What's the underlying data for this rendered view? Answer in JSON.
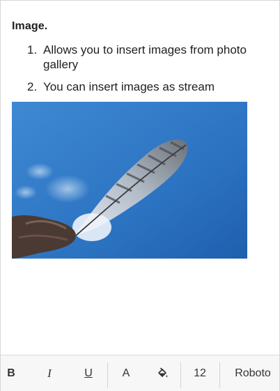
{
  "content": {
    "heading": "Image.",
    "list": [
      {
        "number": "1.",
        "text": "Allows you to insert images from photo gallery"
      },
      {
        "number": "2.",
        "text": "You can insert images as stream"
      }
    ]
  },
  "image": {
    "subject": "feather against blue sky",
    "sky_color": "#2f78c6"
  },
  "toolbar": {
    "bold_label": "B",
    "italic_label": "I",
    "underline_label": "U",
    "font_color_label": "A",
    "highlight_icon": "paint-bucket-icon",
    "font_size": "12",
    "font_family": "Roboto"
  }
}
